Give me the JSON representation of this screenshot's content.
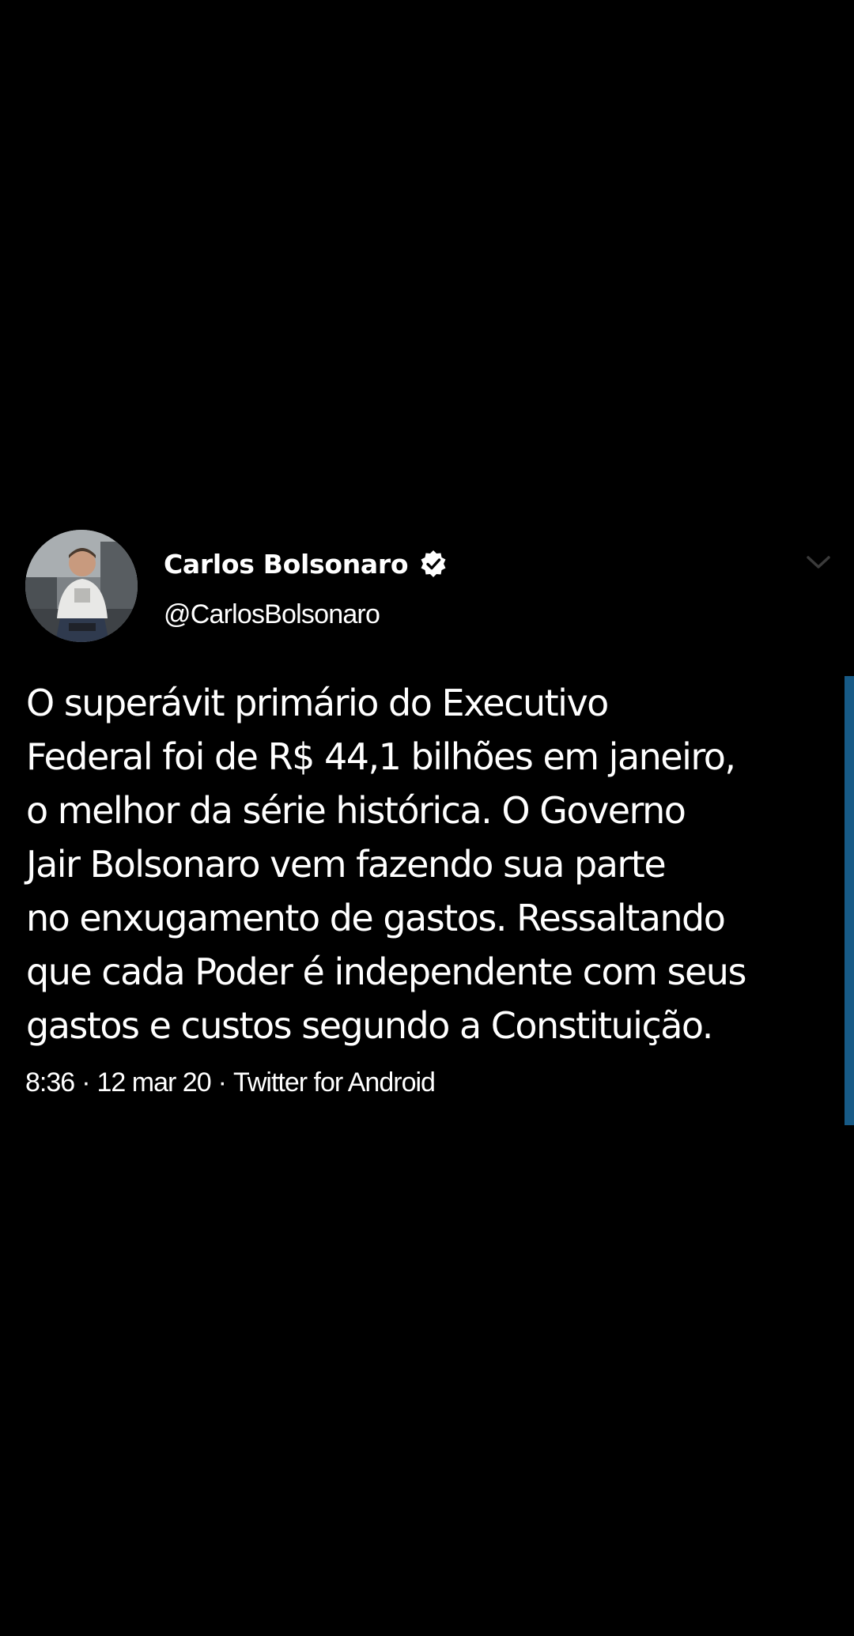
{
  "tweet": {
    "author": {
      "display_name": "Carlos Bolsonaro",
      "handle": "@CarlosBolsonaro",
      "verified": true,
      "avatar_icon": "user-avatar-photo"
    },
    "text_lines": [
      "O superávit primário do Executivo",
      "Federal foi de R$ 44,1 bilhões em janeiro,",
      "o melhor da série histórica. O Governo",
      "Jair Bolsonaro vem fazendo sua parte",
      "no enxugamento de gastos. Ressaltando",
      "que cada Poder é independente com seus",
      "gastos e custos segundo a Constituição."
    ],
    "time": "8:36",
    "date": "12 mar 20",
    "source": "Twitter for Android",
    "separator": "·",
    "menu_icon": "chevron-down-icon"
  },
  "colors": {
    "background": "#000000",
    "text": "#ffffff",
    "scrollbar": "#175a86",
    "caret": "#3a3a3a"
  }
}
